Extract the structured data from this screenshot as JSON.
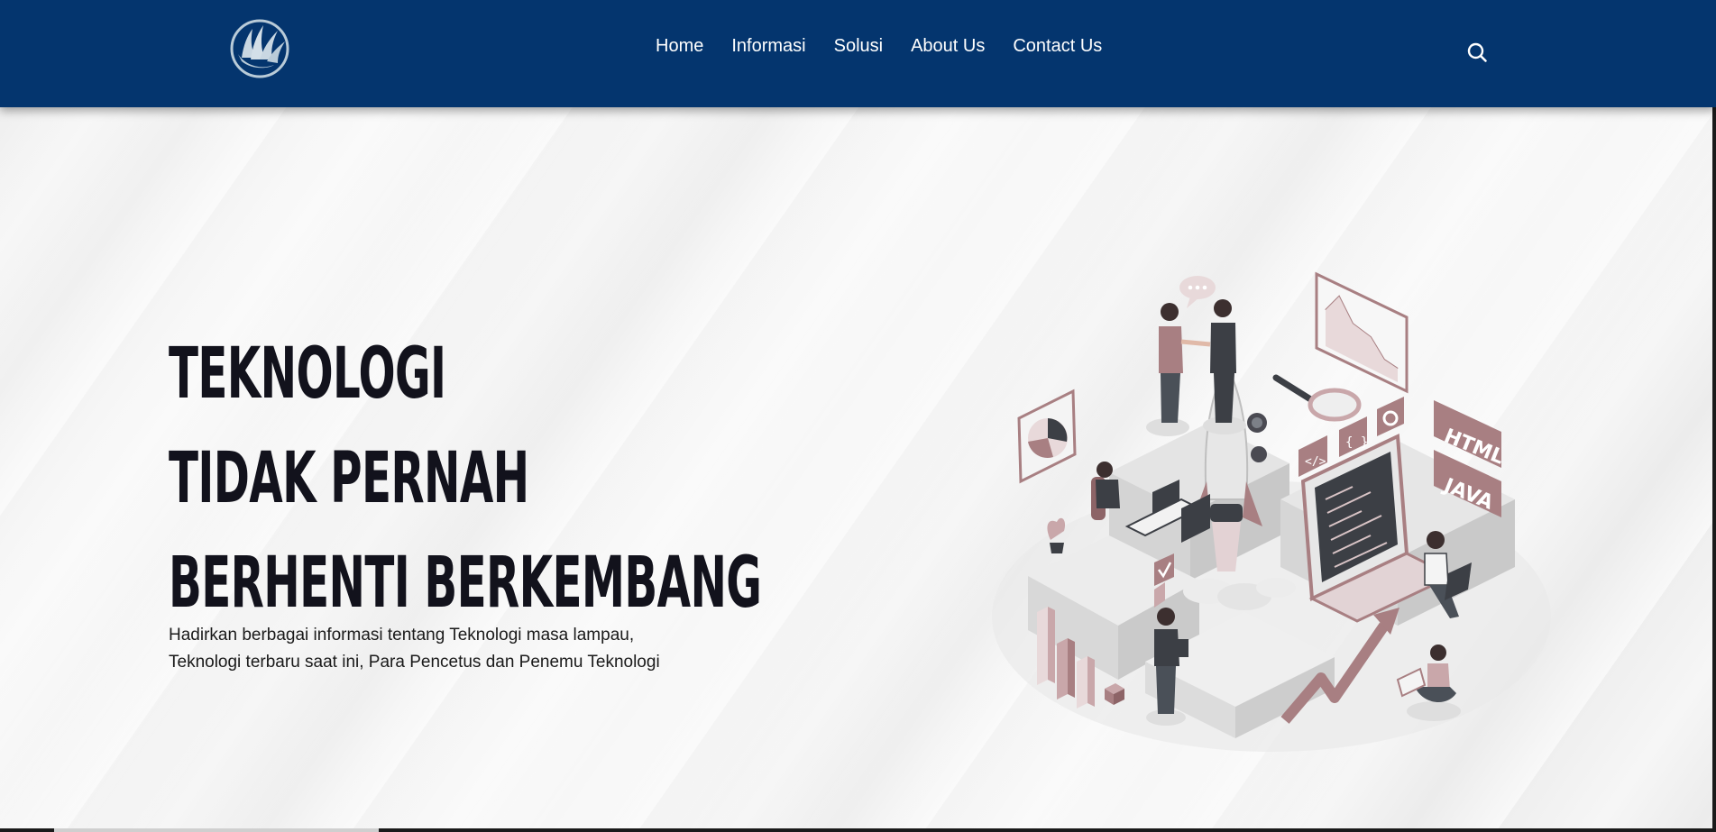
{
  "header": {
    "logo": "leaf-globe-logo",
    "nav": [
      {
        "label": "Home"
      },
      {
        "label": "Informasi"
      },
      {
        "label": "Solusi"
      },
      {
        "label": "About Us"
      },
      {
        "label": "Contact Us"
      }
    ],
    "search_icon": "search-icon"
  },
  "hero": {
    "title_lines": [
      "TEKNOLOGI",
      "TIDAK PERNAH",
      "BERHENTI BERKEMBANG"
    ],
    "description_lines": [
      "Hadirkan berbagai informasi tentang Teknologi masa lampau,",
      "Teknologi terbaru saat ini, Para Pencetus dan Penemu Teknologi"
    ],
    "illustration_labels": [
      "HTML",
      "JAVA"
    ],
    "illustration_icons": [
      "code-tag-icon",
      "braces-icon",
      "gear-icon",
      "pie-chart-icon",
      "speech-bubble-icon"
    ]
  },
  "colors": {
    "header_bg": "#04356e",
    "nav_text": "#ffffff",
    "title_text": "#12121c",
    "accent": "#a87f82"
  }
}
